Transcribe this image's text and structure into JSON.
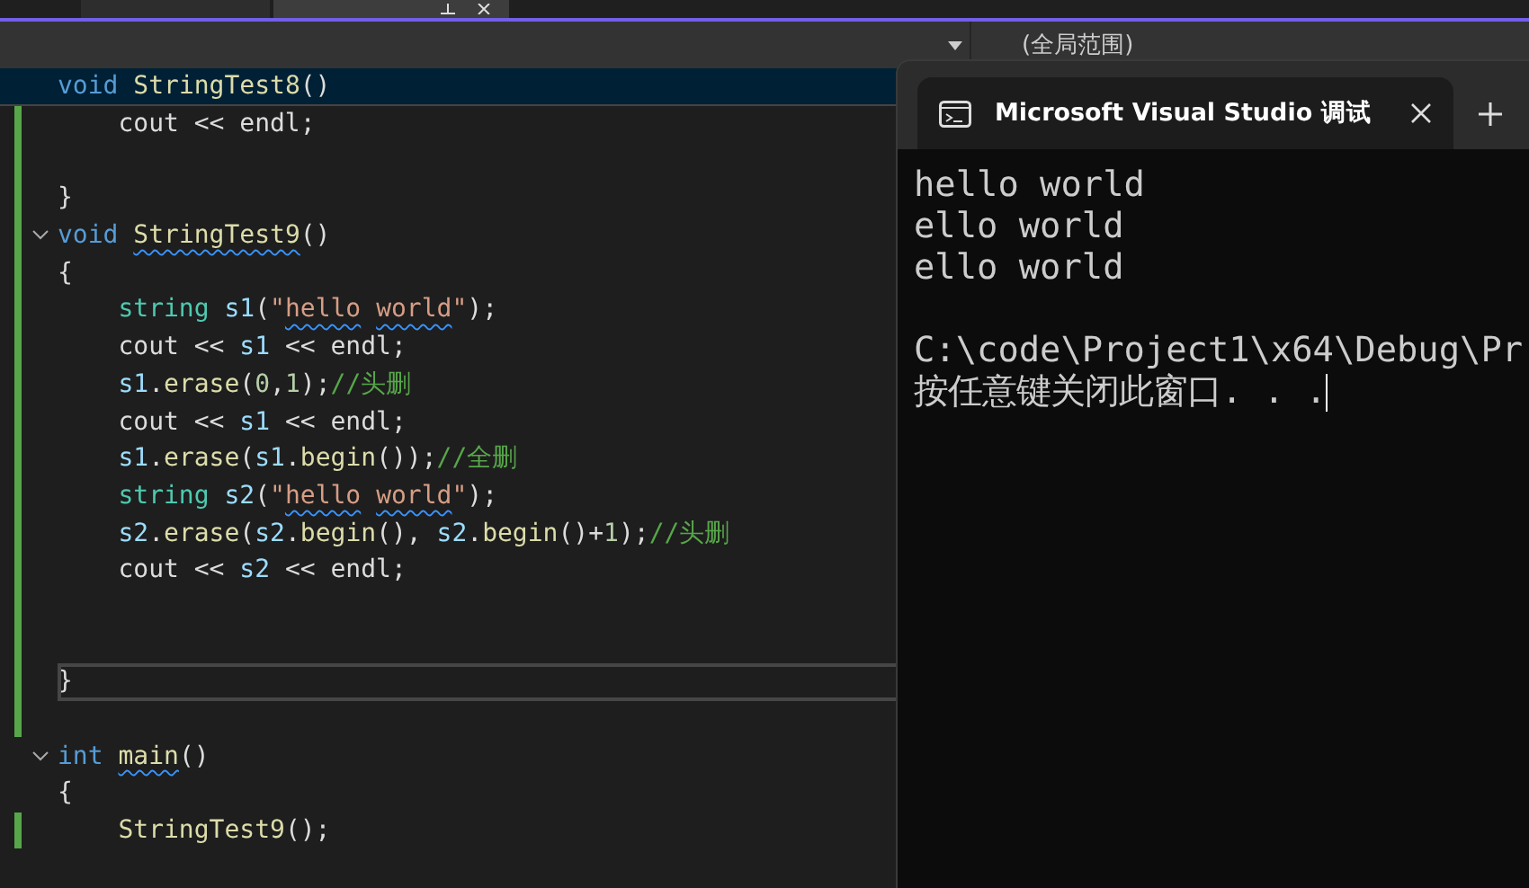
{
  "editor": {
    "tabs": [
      {
        "selected": false
      },
      {
        "selected": true
      }
    ],
    "navigation_bar": {
      "scope": "(全局范围)"
    },
    "code_lines": [
      {
        "highlighted": true,
        "changed": false,
        "tokens": [
          {
            "t": "void",
            "color": "#569cd6"
          },
          {
            "t": " StringTest8",
            "color": "#dcdcaa"
          },
          {
            "t": "()"
          }
        ]
      },
      {
        "changed": true,
        "tokens": [
          {
            "t": "    cout << endl;"
          }
        ]
      },
      {
        "changed": true
      },
      {
        "changed": true,
        "tokens": [
          {
            "t": "}"
          }
        ]
      },
      {
        "changed": true,
        "foldable": true,
        "tokens": [
          {
            "t": "void",
            "color": "#569cd6"
          },
          {
            "t": " StringTest9",
            "color": "#dcdcaa",
            "squiggle": true
          },
          {
            "t": "()"
          }
        ]
      },
      {
        "changed": true,
        "tokens": [
          {
            "t": "{"
          }
        ]
      },
      {
        "changed": true,
        "tokens": [
          {
            "t": "    string",
            "color": "#4ec9b0"
          },
          {
            "t": " s1",
            "color": "#9cdcfe"
          },
          {
            "t": "("
          },
          {
            "t": "\"",
            "color": "#d69d85"
          },
          {
            "t": "hello",
            "color": "#d69d85",
            "squiggle": true
          },
          {
            "t": " world",
            "color": "#d69d85",
            "squiggle": true
          },
          {
            "t": "\"",
            "color": "#d69d85"
          },
          {
            "t": ");"
          }
        ]
      },
      {
        "changed": true,
        "tokens": [
          {
            "t": "    cout << "
          },
          {
            "t": "s1",
            "color": "#9cdcfe"
          },
          {
            "t": " << endl;"
          }
        ]
      },
      {
        "changed": true,
        "tokens": [
          {
            "t": "    s1",
            "color": "#9cdcfe"
          },
          {
            "t": "."
          },
          {
            "t": "erase",
            "color": "#dcdcaa"
          },
          {
            "t": "("
          },
          {
            "t": "0",
            "color": "#b5cea8"
          },
          {
            "t": ","
          },
          {
            "t": "1",
            "color": "#b5cea8"
          },
          {
            "t": ");"
          },
          {
            "t": "//头删",
            "color": "#57a64a"
          }
        ]
      },
      {
        "changed": true,
        "tokens": [
          {
            "t": "    cout << "
          },
          {
            "t": "s1",
            "color": "#9cdcfe"
          },
          {
            "t": " << endl;"
          }
        ]
      },
      {
        "changed": true,
        "tokens": [
          {
            "t": "    s1",
            "color": "#9cdcfe"
          },
          {
            "t": "."
          },
          {
            "t": "erase",
            "color": "#dcdcaa"
          },
          {
            "t": "("
          },
          {
            "t": "s1",
            "color": "#9cdcfe"
          },
          {
            "t": "."
          },
          {
            "t": "begin",
            "color": "#dcdcaa"
          },
          {
            "t": "());"
          },
          {
            "t": "//全删",
            "color": "#57a64a"
          }
        ]
      },
      {
        "changed": true,
        "tokens": [
          {
            "t": "    string",
            "color": "#4ec9b0"
          },
          {
            "t": " s2",
            "color": "#9cdcfe"
          },
          {
            "t": "("
          },
          {
            "t": "\"",
            "color": "#d69d85"
          },
          {
            "t": "hello",
            "color": "#d69d85",
            "squiggle": true
          },
          {
            "t": " world",
            "color": "#d69d85",
            "squiggle": true
          },
          {
            "t": "\"",
            "color": "#d69d85"
          },
          {
            "t": ");"
          }
        ]
      },
      {
        "changed": true,
        "tokens": [
          {
            "t": "    s2",
            "color": "#9cdcfe"
          },
          {
            "t": "."
          },
          {
            "t": "erase",
            "color": "#dcdcaa"
          },
          {
            "t": "("
          },
          {
            "t": "s2",
            "color": "#9cdcfe"
          },
          {
            "t": "."
          },
          {
            "t": "begin",
            "color": "#dcdcaa"
          },
          {
            "t": "(), "
          },
          {
            "t": "s2",
            "color": "#9cdcfe"
          },
          {
            "t": "."
          },
          {
            "t": "begin",
            "color": "#dcdcaa"
          },
          {
            "t": "()+"
          },
          {
            "t": "1",
            "color": "#b5cea8"
          },
          {
            "t": ");"
          },
          {
            "t": "//头删",
            "color": "#57a64a"
          }
        ]
      },
      {
        "changed": true,
        "tokens": [
          {
            "t": "    cout << "
          },
          {
            "t": "s2",
            "color": "#9cdcfe"
          },
          {
            "t": " << endl;"
          }
        ]
      },
      {
        "changed": true
      },
      {
        "changed": true
      },
      {
        "changed": true,
        "current": true,
        "tokens": [
          {
            "t": "}"
          }
        ]
      },
      {
        "changed": true
      },
      {
        "changed": false,
        "foldable": true,
        "tokens": [
          {
            "t": "int",
            "color": "#569cd6"
          },
          {
            "t": " main",
            "color": "#dcdcaa",
            "squiggle": true
          },
          {
            "t": "()"
          }
        ]
      },
      {
        "changed": false,
        "tokens": [
          {
            "t": "{"
          }
        ]
      },
      {
        "changed": true,
        "tokens": [
          {
            "t": "    StringTest9",
            "color": "#dcdcaa"
          },
          {
            "t": "();"
          }
        ]
      },
      {
        "changed": false
      }
    ]
  },
  "console_window": {
    "tab_title": "Microsoft Visual Studio 调试",
    "output_lines": [
      "hello world",
      "ello world",
      "ello world"
    ],
    "exit_path": "C:\\code\\Project1\\x64\\Debug\\Pr",
    "exit_message": "按任意键关闭此窗口. . .",
    "cursor": true
  }
}
